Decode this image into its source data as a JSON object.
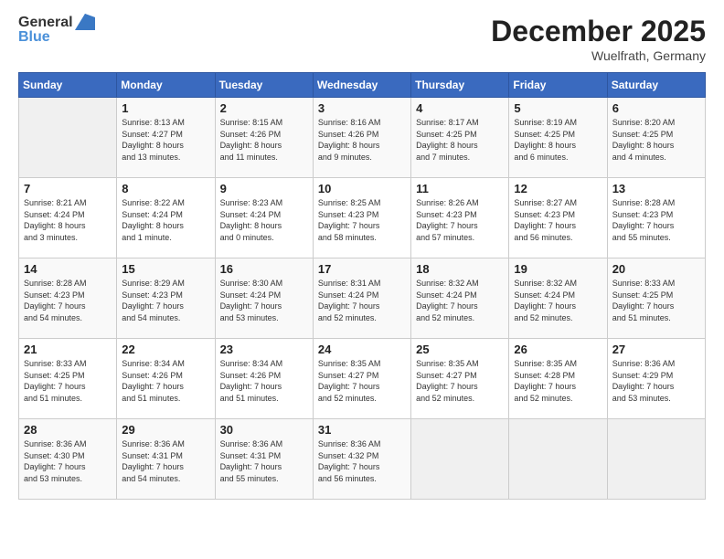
{
  "header": {
    "logo_general": "General",
    "logo_blue": "Blue",
    "month_title": "December 2025",
    "location": "Wuelfrath, Germany"
  },
  "weekdays": [
    "Sunday",
    "Monday",
    "Tuesday",
    "Wednesday",
    "Thursday",
    "Friday",
    "Saturday"
  ],
  "weeks": [
    [
      {
        "day": "",
        "info": ""
      },
      {
        "day": "1",
        "info": "Sunrise: 8:13 AM\nSunset: 4:27 PM\nDaylight: 8 hours\nand 13 minutes."
      },
      {
        "day": "2",
        "info": "Sunrise: 8:15 AM\nSunset: 4:26 PM\nDaylight: 8 hours\nand 11 minutes."
      },
      {
        "day": "3",
        "info": "Sunrise: 8:16 AM\nSunset: 4:26 PM\nDaylight: 8 hours\nand 9 minutes."
      },
      {
        "day": "4",
        "info": "Sunrise: 8:17 AM\nSunset: 4:25 PM\nDaylight: 8 hours\nand 7 minutes."
      },
      {
        "day": "5",
        "info": "Sunrise: 8:19 AM\nSunset: 4:25 PM\nDaylight: 8 hours\nand 6 minutes."
      },
      {
        "day": "6",
        "info": "Sunrise: 8:20 AM\nSunset: 4:25 PM\nDaylight: 8 hours\nand 4 minutes."
      }
    ],
    [
      {
        "day": "7",
        "info": "Sunrise: 8:21 AM\nSunset: 4:24 PM\nDaylight: 8 hours\nand 3 minutes."
      },
      {
        "day": "8",
        "info": "Sunrise: 8:22 AM\nSunset: 4:24 PM\nDaylight: 8 hours\nand 1 minute."
      },
      {
        "day": "9",
        "info": "Sunrise: 8:23 AM\nSunset: 4:24 PM\nDaylight: 8 hours\nand 0 minutes."
      },
      {
        "day": "10",
        "info": "Sunrise: 8:25 AM\nSunset: 4:23 PM\nDaylight: 7 hours\nand 58 minutes."
      },
      {
        "day": "11",
        "info": "Sunrise: 8:26 AM\nSunset: 4:23 PM\nDaylight: 7 hours\nand 57 minutes."
      },
      {
        "day": "12",
        "info": "Sunrise: 8:27 AM\nSunset: 4:23 PM\nDaylight: 7 hours\nand 56 minutes."
      },
      {
        "day": "13",
        "info": "Sunrise: 8:28 AM\nSunset: 4:23 PM\nDaylight: 7 hours\nand 55 minutes."
      }
    ],
    [
      {
        "day": "14",
        "info": "Sunrise: 8:28 AM\nSunset: 4:23 PM\nDaylight: 7 hours\nand 54 minutes."
      },
      {
        "day": "15",
        "info": "Sunrise: 8:29 AM\nSunset: 4:23 PM\nDaylight: 7 hours\nand 54 minutes."
      },
      {
        "day": "16",
        "info": "Sunrise: 8:30 AM\nSunset: 4:24 PM\nDaylight: 7 hours\nand 53 minutes."
      },
      {
        "day": "17",
        "info": "Sunrise: 8:31 AM\nSunset: 4:24 PM\nDaylight: 7 hours\nand 52 minutes."
      },
      {
        "day": "18",
        "info": "Sunrise: 8:32 AM\nSunset: 4:24 PM\nDaylight: 7 hours\nand 52 minutes."
      },
      {
        "day": "19",
        "info": "Sunrise: 8:32 AM\nSunset: 4:24 PM\nDaylight: 7 hours\nand 52 minutes."
      },
      {
        "day": "20",
        "info": "Sunrise: 8:33 AM\nSunset: 4:25 PM\nDaylight: 7 hours\nand 51 minutes."
      }
    ],
    [
      {
        "day": "21",
        "info": "Sunrise: 8:33 AM\nSunset: 4:25 PM\nDaylight: 7 hours\nand 51 minutes."
      },
      {
        "day": "22",
        "info": "Sunrise: 8:34 AM\nSunset: 4:26 PM\nDaylight: 7 hours\nand 51 minutes."
      },
      {
        "day": "23",
        "info": "Sunrise: 8:34 AM\nSunset: 4:26 PM\nDaylight: 7 hours\nand 51 minutes."
      },
      {
        "day": "24",
        "info": "Sunrise: 8:35 AM\nSunset: 4:27 PM\nDaylight: 7 hours\nand 52 minutes."
      },
      {
        "day": "25",
        "info": "Sunrise: 8:35 AM\nSunset: 4:27 PM\nDaylight: 7 hours\nand 52 minutes."
      },
      {
        "day": "26",
        "info": "Sunrise: 8:35 AM\nSunset: 4:28 PM\nDaylight: 7 hours\nand 52 minutes."
      },
      {
        "day": "27",
        "info": "Sunrise: 8:36 AM\nSunset: 4:29 PM\nDaylight: 7 hours\nand 53 minutes."
      }
    ],
    [
      {
        "day": "28",
        "info": "Sunrise: 8:36 AM\nSunset: 4:30 PM\nDaylight: 7 hours\nand 53 minutes."
      },
      {
        "day": "29",
        "info": "Sunrise: 8:36 AM\nSunset: 4:31 PM\nDaylight: 7 hours\nand 54 minutes."
      },
      {
        "day": "30",
        "info": "Sunrise: 8:36 AM\nSunset: 4:31 PM\nDaylight: 7 hours\nand 55 minutes."
      },
      {
        "day": "31",
        "info": "Sunrise: 8:36 AM\nSunset: 4:32 PM\nDaylight: 7 hours\nand 56 minutes."
      },
      {
        "day": "",
        "info": ""
      },
      {
        "day": "",
        "info": ""
      },
      {
        "day": "",
        "info": ""
      }
    ]
  ]
}
